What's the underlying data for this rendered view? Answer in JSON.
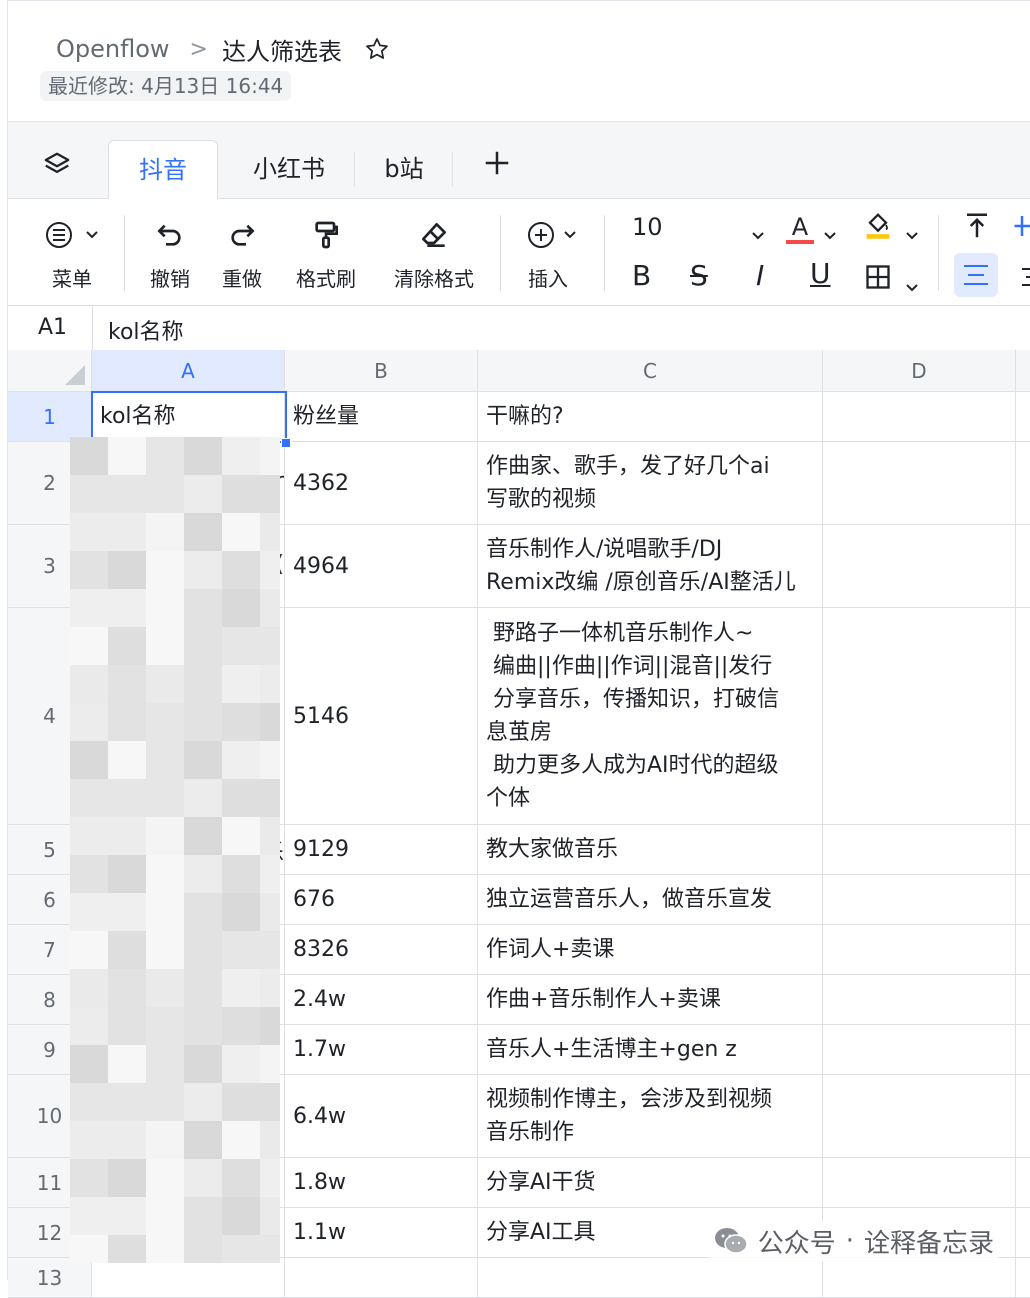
{
  "header": {
    "workspace": "Openflow",
    "separator": ">",
    "doc_title": "达人筛选表",
    "last_modified": "最近修改: 4月13日 16:44"
  },
  "tabs": [
    "抖音",
    "小红书",
    "b站"
  ],
  "active_tab": 0,
  "toolbar": {
    "menu": "菜单",
    "undo": "撤销",
    "redo": "重做",
    "format_painter": "格式刷",
    "clear_format": "清除格式",
    "insert": "插入",
    "font_size": "10",
    "bold": "B",
    "strike": "S",
    "italic": "I",
    "underline": "U",
    "text_color_letter": "A"
  },
  "formula_bar": {
    "cell_ref": "A1",
    "value": "kol名称"
  },
  "columns": [
    "A",
    "B",
    "C",
    "D"
  ],
  "rows": [
    {
      "n": "1",
      "a": "kol名称",
      "b": "粉丝量",
      "c": "干嘛的?"
    },
    {
      "n": "2",
      "a": "",
      "b": "4362",
      "c": "作曲家、歌手，发了好几个ai\n写歌的视频"
    },
    {
      "n": "3",
      "a": "",
      "b": "4964",
      "c": "音乐制作人/说唱歌手/DJ\nRemix改编 /原创音乐/AI整活儿"
    },
    {
      "n": "4",
      "a": "",
      "b": "5146",
      "c": " 野路子一体机音乐制作人~\n 编曲||作曲||作词||混音||发行\n 分享音乐，传播知识，打破信\n息茧房\n 助力更多人成为AI时代的超级\n个体"
    },
    {
      "n": "5",
      "a": "",
      "b": "9129",
      "c": "教大家做音乐"
    },
    {
      "n": "6",
      "a": "",
      "b": "676",
      "c": "独立运营音乐人，做音乐宣发"
    },
    {
      "n": "7",
      "a": "",
      "b": "8326",
      "c": "作词人+卖课"
    },
    {
      "n": "8",
      "a": "",
      "b": "2.4w",
      "c": "作曲+音乐制作人+卖课"
    },
    {
      "n": "9",
      "a": "",
      "b": "1.7w",
      "c": "音乐人+生活博主+gen z"
    },
    {
      "n": "10",
      "a": "",
      "b": "6.4w",
      "c": "视频制作博主，会涉及到视频\n音乐制作"
    },
    {
      "n": "11",
      "a": "",
      "b": "1.8w",
      "c": "分享AI干货"
    },
    {
      "n": "12",
      "a": "",
      "b": "1.1w",
      "c": "分享AI工具"
    },
    {
      "n": "13",
      "a": "",
      "b": "",
      "c": ""
    }
  ],
  "partial_a_chars": [
    "or",
    ")",
    "乐"
  ],
  "watermark": {
    "left": "公众号",
    "dot": "·",
    "right": "诠释备忘录"
  },
  "colors": {
    "accent": "#3370ff",
    "grid": "#dee0e3",
    "header_bg": "#f5f6f7",
    "text": "#1f2329",
    "red_underline": "#f54a45",
    "yellow_fill": "#ffc60a"
  }
}
